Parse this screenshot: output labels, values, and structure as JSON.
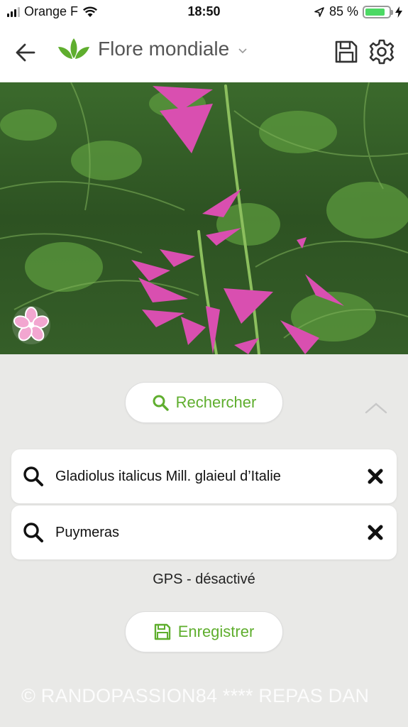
{
  "status_bar": {
    "carrier": "Orange F",
    "time": "18:50",
    "battery_text": "85 %",
    "battery_level": 0.85
  },
  "navbar": {
    "title": "Flore mondiale",
    "icons": [
      "back-arrow-icon",
      "leaf-logo-icon",
      "chevron-down-icon",
      "save-icon",
      "gear-icon"
    ]
  },
  "search_button": {
    "label": "Rechercher"
  },
  "fields": [
    {
      "value": "Gladiolus italicus Mill. glaieul d’Italie"
    },
    {
      "value": "Puymeras"
    }
  ],
  "gps_status": "GPS - désactivé",
  "save_button": {
    "label": "Enregistrer"
  },
  "watermark": "© RANDOPASSION84 ****   REPAS DAN",
  "colors": {
    "accent": "#5fae2e",
    "flower": "#d94fb0",
    "battery": "#4cd964"
  }
}
